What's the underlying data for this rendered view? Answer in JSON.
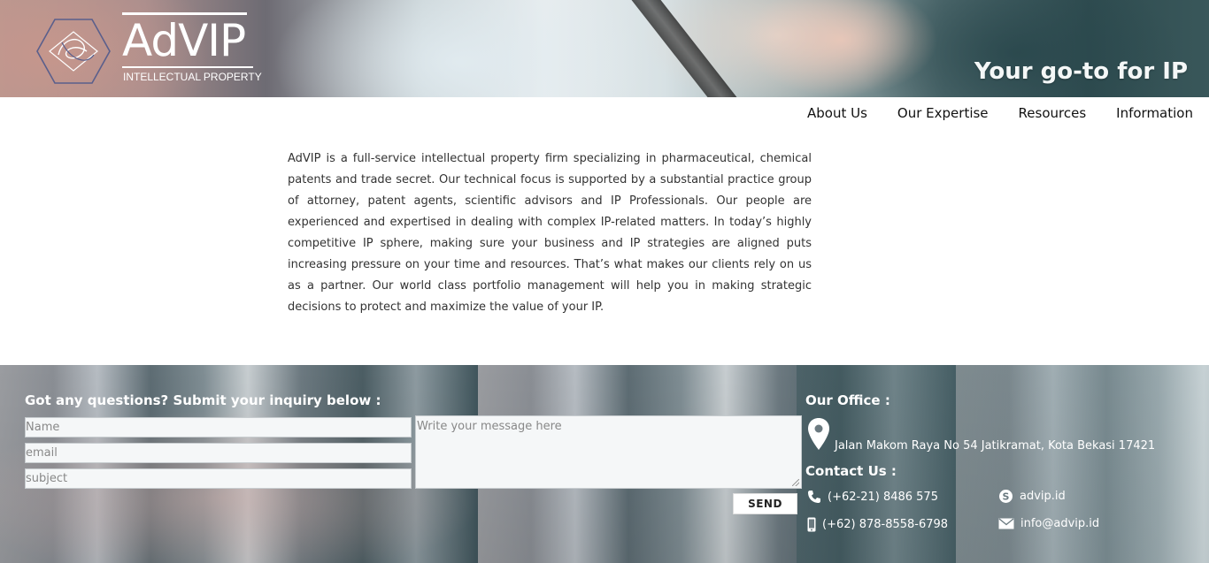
{
  "header": {
    "logo_name": "AdVIP",
    "logo_subtitle": "INTELLECTUAL PROPERTY",
    "tagline": "Your go-to for IP"
  },
  "nav": {
    "items": [
      {
        "label": "About Us"
      },
      {
        "label": "Our Expertise"
      },
      {
        "label": "Resources"
      },
      {
        "label": "Information"
      }
    ]
  },
  "intro": {
    "text": "AdVIP is a full-service intellectual property firm specializing in pharmaceutical, chemical patents and trade secret. Our technical focus is supported by a substantial practice group of attorney, patent agents, scientific advisors and IP Professionals. Our people are experienced and expertised in dealing with complex IP-related matters. In today’s highly competitive IP sphere, making sure your business and IP strategies are aligned puts increasing pressure on your time and resources. That’s what makes our clients rely on us as a partner. Our world class portfolio management will help you in making strategic decisions to protect and maximize the value of your IP."
  },
  "inquiry": {
    "title": "Got any questions? Submit your inquiry below :",
    "name_placeholder": "Name",
    "email_placeholder": "email",
    "subject_placeholder": "subject",
    "message_placeholder": "Write your message here",
    "send_label": "SEND"
  },
  "office": {
    "title": "Our Office :",
    "address": "Jalan Makom Raya No 54 Jatikramat, Kota Bekasi 17421"
  },
  "contact": {
    "title": "Contact Us :",
    "phone": "(+62-21) 8486 575",
    "mobile": "(+62) 878-8558-6798",
    "skype": "advip.id",
    "email": "info@advip.id"
  },
  "icons": {
    "pin": "map-pin-icon",
    "phone": "phone-icon",
    "mobile": "mobile-icon",
    "skype": "skype-icon",
    "mail": "mail-icon"
  }
}
